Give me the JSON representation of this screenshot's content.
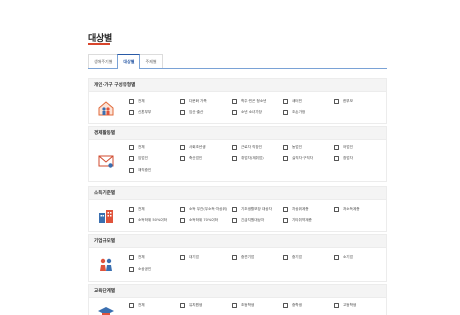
{
  "page": {
    "title": "대상별"
  },
  "tabs": [
    {
      "label": "생애주기별",
      "active": false
    },
    {
      "label": "대상별",
      "active": true
    },
    {
      "label": "주제별",
      "active": false
    }
  ],
  "sections": [
    {
      "title": "개인·가구 구성유형별",
      "icon": "family-home-icon",
      "options": [
        "전체",
        "다문화 가족",
        "학주·빈곤 청소년",
        "새터민",
        "한부모",
        "신혼부부",
        "임산·출산",
        "소년 소녀가장",
        "조손가정"
      ]
    },
    {
      "title": "경제활동별",
      "icon": "mail-envelope-icon",
      "options": [
        "전체",
        "사회초년생",
        "근로자 직장인",
        "농업인",
        "어업인",
        "임업인",
        "축산업인",
        "취업자(재취업)",
        "실직자·구직자",
        "창업자",
        "재직중인"
      ]
    },
    {
      "title": "소득기준별",
      "icon": "buildings-icon",
      "options": [
        "전체",
        "소득 무관(무소득·차상위)",
        "기초생활보장 대상자",
        "차상위계층",
        "저소득계층",
        "소득하위 50%이하",
        "소득하위 70%이하",
        "긴급지원대상자",
        "기타취약계층"
      ]
    },
    {
      "title": "기업규모별",
      "icon": "people-business-icon",
      "options": [
        "전체",
        "대기업",
        "중견기업",
        "중기업",
        "소기업",
        "소상공인"
      ]
    },
    {
      "title": "교육단계별",
      "icon": "graduation-icon",
      "options": [
        "전체",
        "유치원생",
        "초등학생",
        "중학생",
        "고등학생"
      ]
    }
  ],
  "colors": {
    "accent": "#d8452b",
    "tab_active": "#2a5aa6",
    "head_bg": "#f4f4f4"
  }
}
